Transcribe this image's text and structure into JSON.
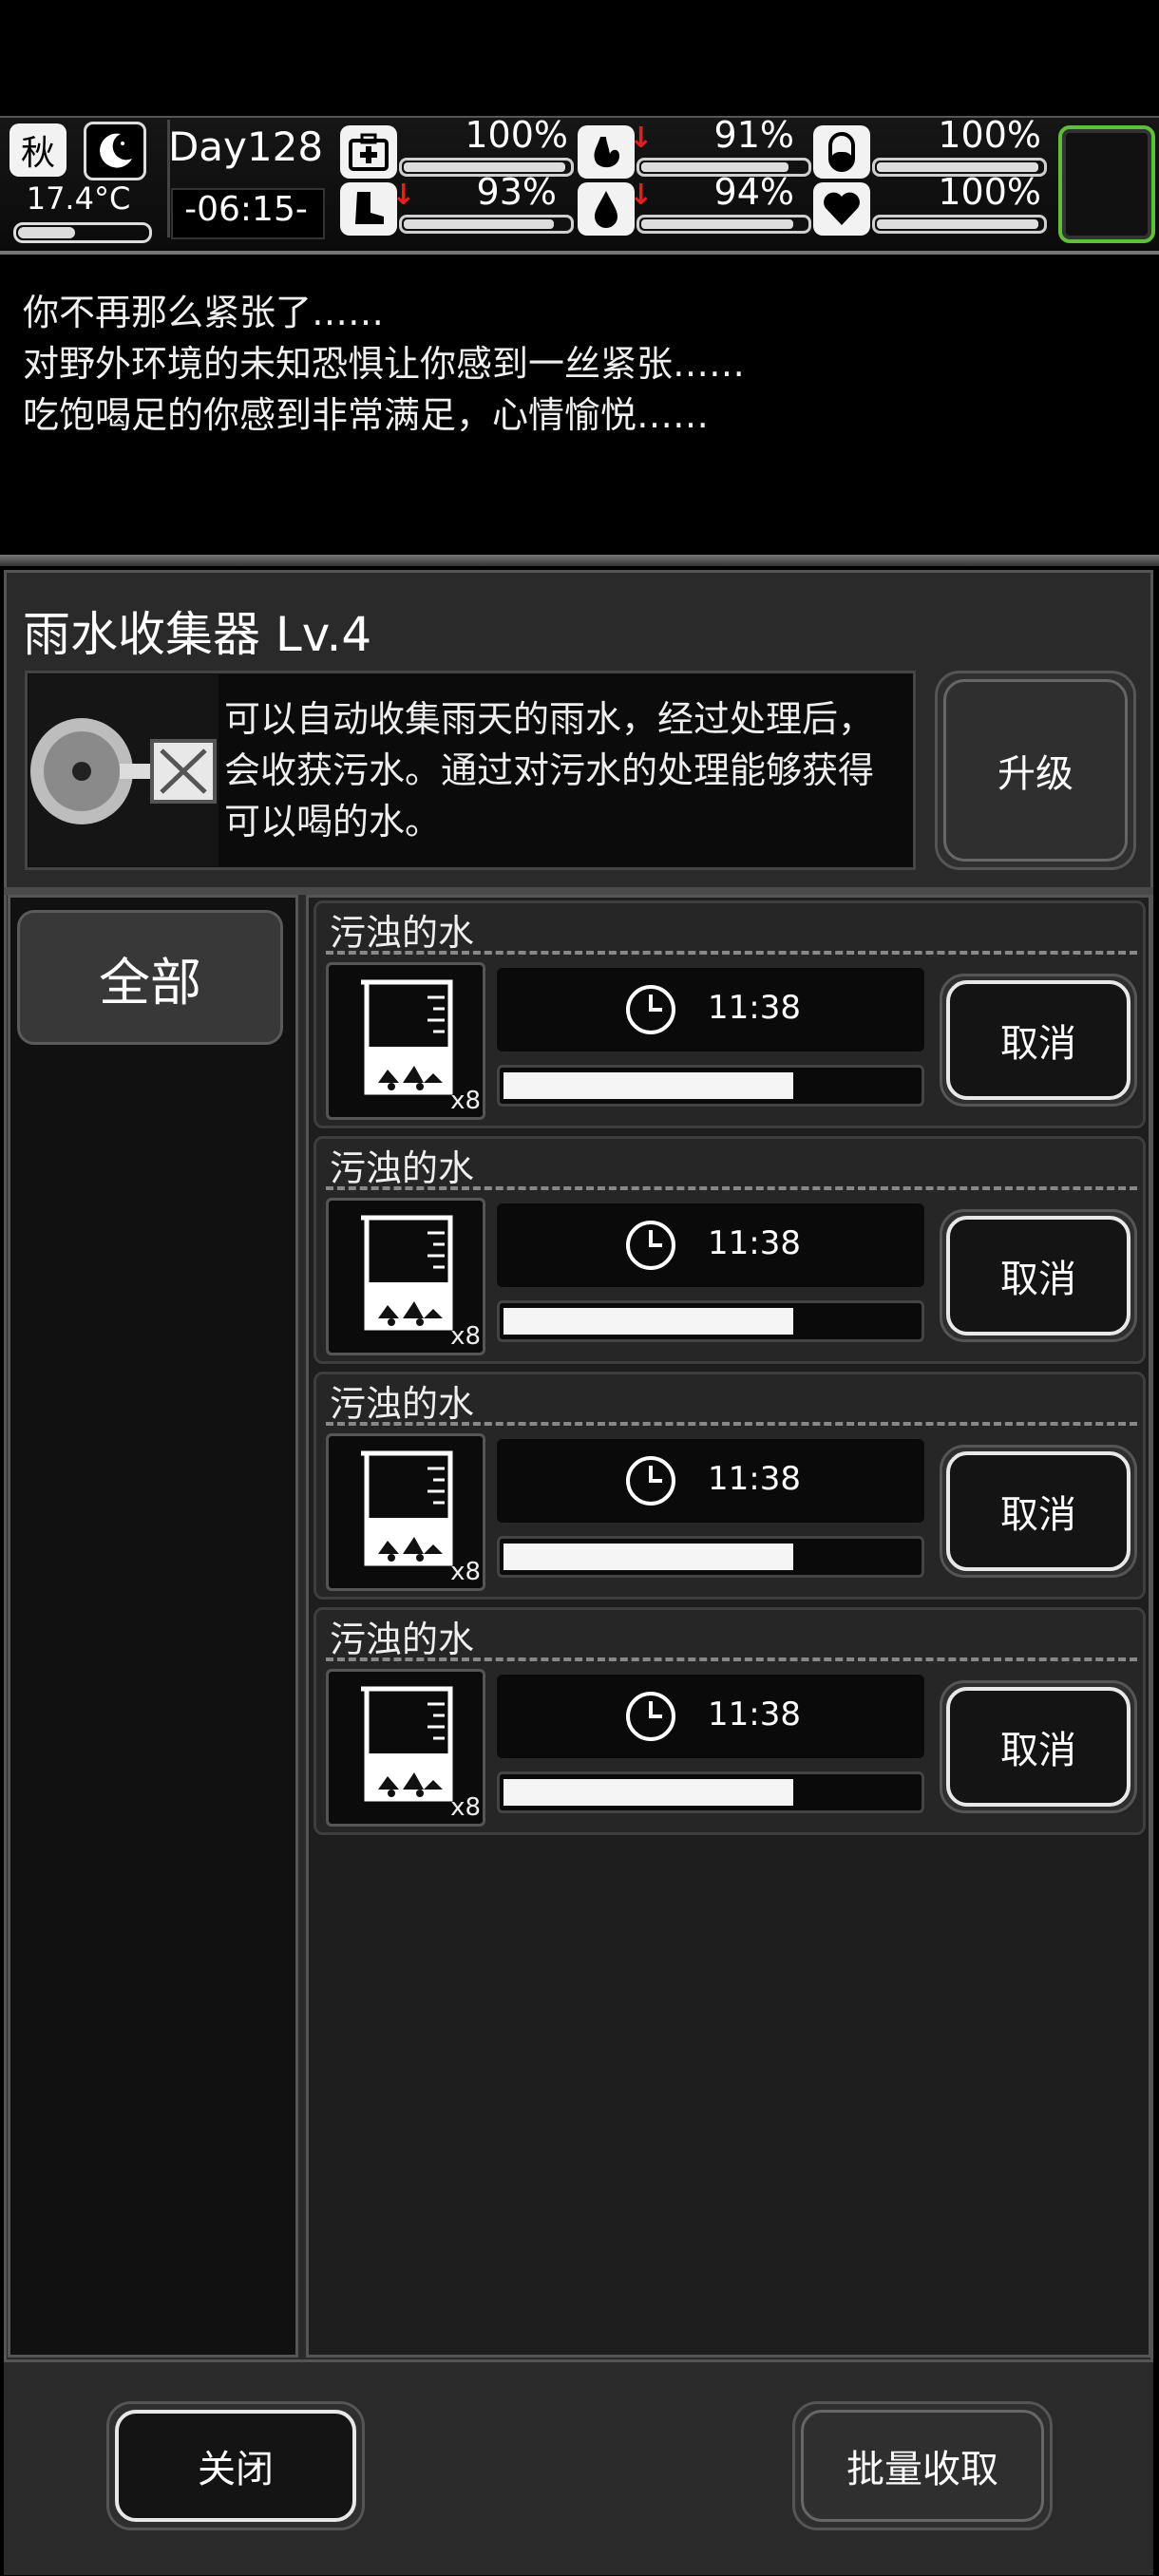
{
  "status": {
    "season": "秋",
    "temperature": "17.4°C",
    "day": "Day128",
    "time": "-06:15-",
    "stats": [
      {
        "icon": "medkit-icon",
        "value": "100%",
        "level": 1.0,
        "down": false
      },
      {
        "icon": "stomach-icon",
        "value": "91%",
        "level": 0.91,
        "down": true
      },
      {
        "icon": "pill-icon",
        "value": "100%",
        "level": 1.0,
        "down": false
      },
      {
        "icon": "boot-icon",
        "value": "93%",
        "level": 0.93,
        "down": true
      },
      {
        "icon": "water-drop-icon",
        "value": "94%",
        "level": 0.94,
        "down": true
      },
      {
        "icon": "heart-icon",
        "value": "100%",
        "level": 1.0,
        "down": false
      }
    ]
  },
  "log": {
    "lines": [
      "你不再那么紧张了……",
      "对野外环境的未知恐惧让你感到一丝紧张……",
      "吃饱喝足的你感到非常满足，心情愉悦……"
    ]
  },
  "panel": {
    "title": "雨水收集器 Lv.4",
    "description": "可以自动收集雨天的雨水，经过处理后，会收获污水。通过对污水的处理能够获得可以喝的水。",
    "upgrade_label": "升级",
    "tab_all": "全部",
    "items": [
      {
        "name": "污浊的水",
        "qty": "x8",
        "time": "11:38",
        "progress": 0.7,
        "cancel": "取消"
      },
      {
        "name": "污浊的水",
        "qty": "x8",
        "time": "11:38",
        "progress": 0.7,
        "cancel": "取消"
      },
      {
        "name": "污浊的水",
        "qty": "x8",
        "time": "11:38",
        "progress": 0.7,
        "cancel": "取消"
      },
      {
        "name": "污浊的水",
        "qty": "x8",
        "time": "11:38",
        "progress": 0.7,
        "cancel": "取消"
      }
    ],
    "close_label": "关闭",
    "collect_all_label": "批量收取"
  }
}
